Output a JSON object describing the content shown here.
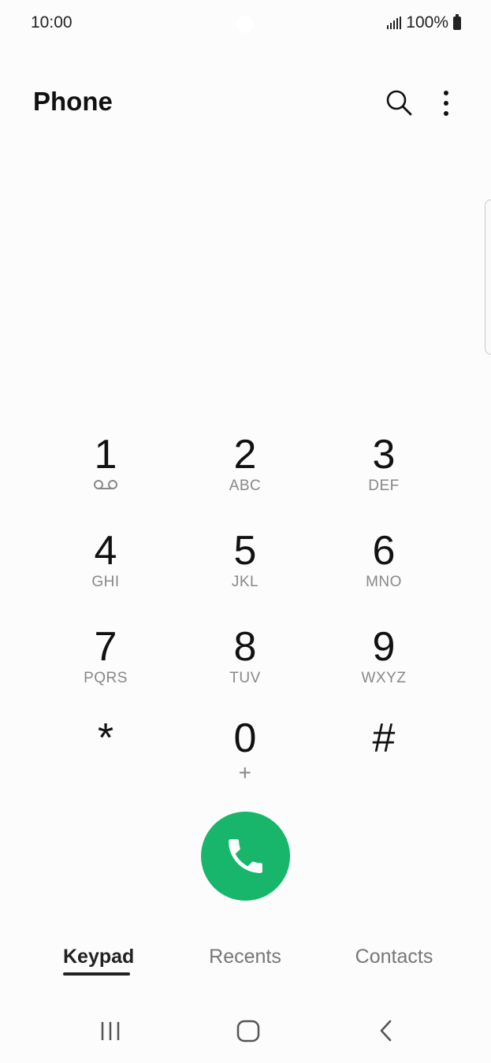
{
  "status_bar": {
    "time": "10:00",
    "battery": "100%"
  },
  "header": {
    "title": "Phone"
  },
  "keypad": [
    {
      "digit": "1",
      "letters": ""
    },
    {
      "digit": "2",
      "letters": "ABC"
    },
    {
      "digit": "3",
      "letters": "DEF"
    },
    {
      "digit": "4",
      "letters": "GHI"
    },
    {
      "digit": "5",
      "letters": "JKL"
    },
    {
      "digit": "6",
      "letters": "MNO"
    },
    {
      "digit": "7",
      "letters": "PQRS"
    },
    {
      "digit": "8",
      "letters": "TUV"
    },
    {
      "digit": "9",
      "letters": "WXYZ"
    },
    {
      "digit": "*",
      "letters": ""
    },
    {
      "digit": "0",
      "letters": "+"
    },
    {
      "digit": "#",
      "letters": ""
    }
  ],
  "tabs": [
    {
      "label": "Keypad",
      "active": true
    },
    {
      "label": "Recents",
      "active": false
    },
    {
      "label": "Contacts",
      "active": false
    }
  ],
  "colors": {
    "call_button": "#17b66a",
    "background": "#fcfcfc"
  },
  "icons": {
    "search": "search-icon",
    "more": "more-vertical-icon",
    "call": "phone-icon",
    "voicemail": "voicemail-icon"
  }
}
